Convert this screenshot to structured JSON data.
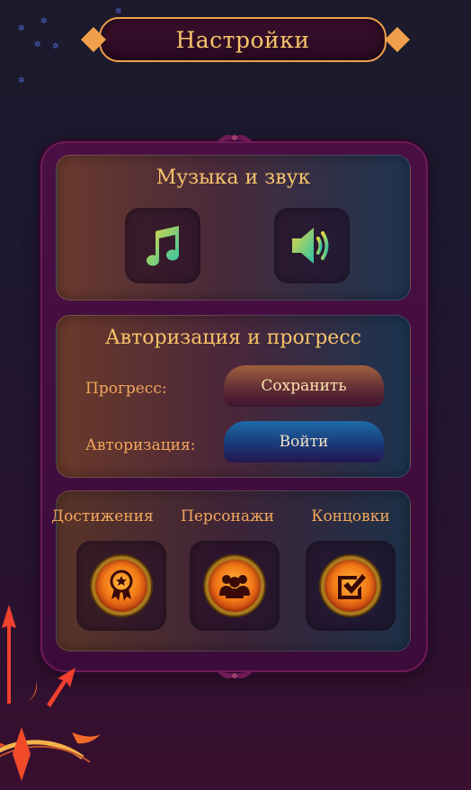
{
  "header": {
    "title": "Настройки"
  },
  "audio": {
    "title": "Музыка и звук",
    "music_icon": "music-note-icon",
    "sound_icon": "speaker-icon"
  },
  "auth": {
    "title": "Авторизация и прогресс",
    "progress_label": "Прогресс:",
    "save_button": "Сохранить",
    "auth_label": "Авторизация:",
    "login_button": "Войти"
  },
  "extras": {
    "achievements_label": "Достижения",
    "characters_label": "Персонажи",
    "endings_label": "Концовки",
    "achievements_icon": "award-badge-icon",
    "characters_icon": "people-group-icon",
    "endings_icon": "checkbox-check-icon"
  },
  "colors": {
    "accent_gold": "#f7c46a",
    "label_orange": "#f3a85a",
    "panel_purple": "#4a0f44",
    "music_gradient": [
      "#e8d840",
      "#2bc4a8"
    ]
  }
}
